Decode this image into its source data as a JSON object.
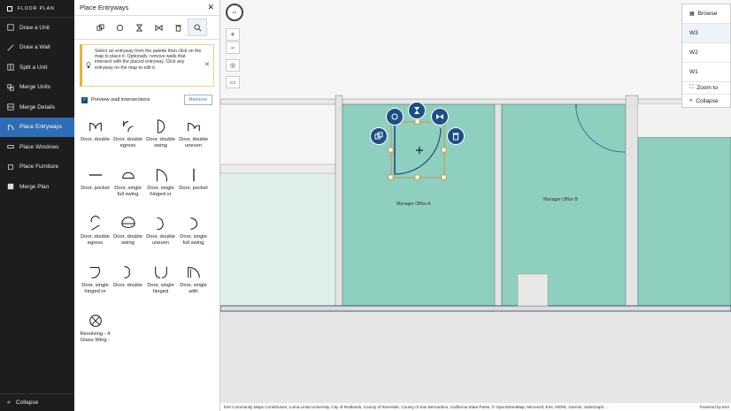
{
  "nav": {
    "title": "FLOOR PLAN",
    "items": [
      {
        "label": "Draw a Unit",
        "icon": "draw-unit-icon"
      },
      {
        "label": "Draw a Wall",
        "icon": "draw-wall-icon"
      },
      {
        "label": "Split a Unit",
        "icon": "split-unit-icon"
      },
      {
        "label": "Merge Units",
        "icon": "merge-units-icon"
      },
      {
        "label": "Merge Details",
        "icon": "merge-details-icon"
      },
      {
        "label": "Place Entryways",
        "icon": "entryway-icon",
        "active": true
      },
      {
        "label": "Place Windows",
        "icon": "window-icon"
      },
      {
        "label": "Place Furniture",
        "icon": "furniture-icon"
      },
      {
        "label": "Merge Plan",
        "icon": "merge-plan-icon"
      }
    ],
    "collapse_label": "Collapse"
  },
  "panel": {
    "title": "Place Entryways",
    "notice": "Select an entryway from the palette then click on the map to place it. Optionally, remove walls that intersect with the placed entryway. Click any entryway on the map to edit it.",
    "preview_label": "Preview wall intersections",
    "remove_label": "Remove",
    "palette": [
      "Door, double",
      "Door, double egress",
      "Door, double swing",
      "Door, double uneven",
      "Door, pocket",
      "Door, single full swing",
      "Door, single hinged or",
      "Door, pocket",
      "Door, double egress",
      "Door, double swing",
      "Door, double uneven",
      "Door, single full swing",
      "Door, single hinged or",
      "Door, double",
      "Door, single hinged",
      "Door, single with",
      "Revolving - 4 Glass Wing -"
    ]
  },
  "map": {
    "rooms": [
      "Manager Office A",
      "Manager Office B"
    ],
    "zoom_in": "+",
    "zoom_out": "−"
  },
  "levels": {
    "browse": "Browse",
    "items": [
      "W3",
      "W2",
      "W1"
    ],
    "selected": "W3",
    "zoom_to": "Zoom to",
    "collapse": "Collapse"
  },
  "attribution": "Esri Community Maps Contributors, Loma Linda University, City of Redlands, County of Riverside, County of San Bernardino, California State Parks, © OpenStreetMap, Microsoft, Esri, HERE, Garmin, SafeGraph, ...",
  "powered_by": "Powered by Esri",
  "colors": {
    "accent": "#2e6db5",
    "room": "#8ecfbf",
    "fab": "#1c4f86",
    "nav_bg": "#1d1d1d"
  }
}
